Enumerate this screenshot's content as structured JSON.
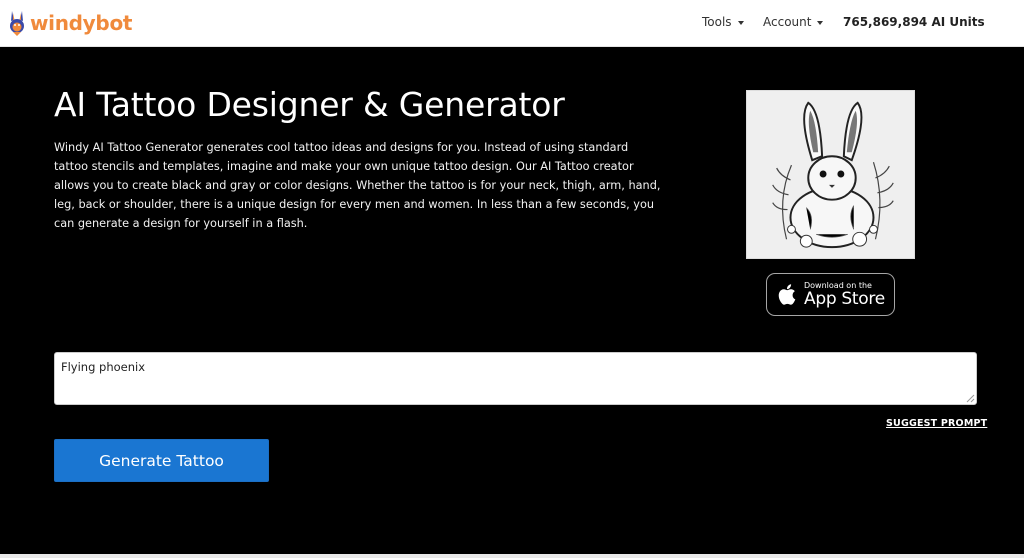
{
  "header": {
    "brand": "windybot",
    "nav": {
      "tools": "Tools",
      "account": "Account",
      "units": "765,869,894 AI Units"
    }
  },
  "hero": {
    "title": "AI Tattoo Designer & Generator",
    "description": "Windy AI Tattoo Generator generates cool tattoo ideas and designs for you. Instead of using standard tattoo stencils and templates, imagine and make your own unique tattoo design. Our AI Tattoo creator allows you to create black and gray or color designs. Whether the tattoo is for your neck, thigh, arm, hand, leg, back or shoulder, there is a unique design for every men and women. In less than a few seconds, you can generate a design for yourself in a flash.",
    "app_store": {
      "small": "Download on the",
      "big": "App Store"
    }
  },
  "form": {
    "prompt_value": "Flying phoenix",
    "suggest_label": "SUGGEST PROMPT",
    "generate_label": "Generate Tattoo"
  },
  "colors": {
    "brand_orange": "#f08a3c",
    "button_blue": "#1a76d2",
    "background": "#000000"
  }
}
